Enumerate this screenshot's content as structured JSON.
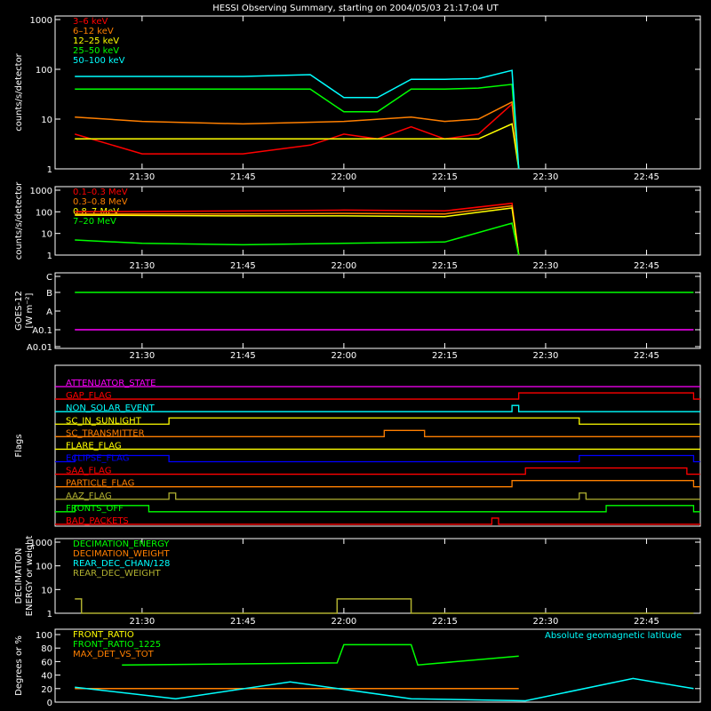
{
  "title": "HESSI Observing Summary, starting on 2004/05/03 21:17:04 UT",
  "colors": {
    "red": "#ff0000",
    "orange": "#ff7f00",
    "yellow": "#ffff00",
    "green": "#00ff00",
    "cyan": "#00ffff",
    "magenta": "#ff00ff",
    "blue": "#0000ff",
    "olive": "#b0b030",
    "white": "#ffffff",
    "axis": "#ffffff"
  },
  "chart_data": [
    {
      "id": "low_energy",
      "type": "line",
      "ylabel": "counts/s/detector",
      "log": true,
      "yticks": [
        "1",
        "10",
        "100",
        "1000"
      ],
      "yrange": [
        1,
        1000
      ],
      "xticks": [
        "21:30",
        "21:45",
        "22:00",
        "22:15",
        "22:30",
        "22:45"
      ],
      "legend": [
        "3–6 keV",
        "6–12 keV",
        "12–25 keV",
        "25–50 keV",
        "50–100 keV"
      ],
      "legend_colors": [
        "red",
        "orange",
        "yellow",
        "green",
        "cyan"
      ],
      "series": [
        {
          "name": "3–6 keV",
          "color": "red",
          "x": [
            "21:20",
            "21:30",
            "21:45",
            "21:55",
            "22:00",
            "22:05",
            "22:10",
            "22:15",
            "22:20",
            "22:25",
            "22:26"
          ],
          "y": [
            5,
            2,
            2,
            3,
            5,
            4,
            7,
            4,
            5,
            20,
            1
          ]
        },
        {
          "name": "6–12 keV",
          "color": "orange",
          "x": [
            "21:20",
            "21:30",
            "21:45",
            "22:00",
            "22:10",
            "22:15",
            "22:20",
            "22:25",
            "22:26"
          ],
          "y": [
            11,
            9,
            8,
            9,
            11,
            9,
            10,
            22,
            1
          ]
        },
        {
          "name": "12–25 keV",
          "color": "yellow",
          "x": [
            "21:20",
            "21:30",
            "21:45",
            "22:00",
            "22:15",
            "22:20",
            "22:25",
            "22:26"
          ],
          "y": [
            4,
            4,
            4,
            4,
            4,
            4,
            8,
            1
          ]
        },
        {
          "name": "25–50 keV",
          "color": "green",
          "x": [
            "21:20",
            "21:30",
            "21:45",
            "21:55",
            "22:00",
            "22:05",
            "22:10",
            "22:15",
            "22:20",
            "22:25",
            "22:26"
          ],
          "y": [
            40,
            40,
            40,
            40,
            14,
            14,
            40,
            40,
            42,
            50,
            1
          ]
        },
        {
          "name": "50–100 keV",
          "color": "cyan",
          "x": [
            "21:20",
            "21:30",
            "21:45",
            "21:55",
            "22:00",
            "22:05",
            "22:10",
            "22:15",
            "22:20",
            "22:25",
            "22:26"
          ],
          "y": [
            72,
            72,
            72,
            78,
            27,
            27,
            63,
            63,
            65,
            95,
            1
          ]
        }
      ]
    },
    {
      "id": "high_energy",
      "type": "line",
      "ylabel": "counts/s/detector",
      "log": true,
      "yticks": [
        "1",
        "10",
        "100",
        "1000"
      ],
      "yrange": [
        1,
        1000
      ],
      "xticks": [
        "21:30",
        "21:45",
        "22:00",
        "22:15",
        "22:30",
        "22:45"
      ],
      "legend": [
        "0.1–0.3 MeV",
        "0.3–0.8 MeV",
        "0.8–7 MeV",
        "7–20 MeV"
      ],
      "legend_colors": [
        "red",
        "orange",
        "yellow",
        "green"
      ],
      "series": [
        {
          "name": "0.1–0.3 MeV",
          "color": "red",
          "x": [
            "21:20",
            "21:45",
            "22:00",
            "22:15",
            "22:25",
            "22:26"
          ],
          "y": [
            100,
            110,
            120,
            110,
            250,
            1
          ]
        },
        {
          "name": "0.3–0.8 MeV",
          "color": "orange",
          "x": [
            "21:20",
            "21:45",
            "22:00",
            "22:15",
            "22:25",
            "22:26"
          ],
          "y": [
            80,
            80,
            85,
            80,
            190,
            1
          ]
        },
        {
          "name": "0.8–7 MeV",
          "color": "yellow",
          "x": [
            "21:20",
            "21:45",
            "22:00",
            "22:15",
            "22:25",
            "22:26"
          ],
          "y": [
            70,
            65,
            65,
            60,
            150,
            1
          ]
        },
        {
          "name": "7–20 MeV",
          "color": "green",
          "x": [
            "21:20",
            "21:30",
            "21:45",
            "22:00",
            "22:15",
            "22:25",
            "22:26"
          ],
          "y": [
            5,
            3.5,
            3,
            3.5,
            4,
            30,
            1
          ]
        }
      ]
    },
    {
      "id": "goes",
      "type": "line",
      "ylabel": "GOES-12",
      "ylabel2": "[W m⁻²]",
      "yticks": [
        "A0.01",
        "A0.1",
        "A",
        "B",
        "C"
      ],
      "xticks": [
        "21:30",
        "21:45",
        "22:00",
        "22:15",
        "22:30",
        "22:45"
      ],
      "series": [
        {
          "name": "",
          "color": "green",
          "x": [
            "21:20",
            "22:52"
          ],
          "y": [
            "B",
            "B"
          ]
        },
        {
          "name": "",
          "color": "magenta",
          "x": [
            "21:20",
            "22:52"
          ],
          "y": [
            "A0.1",
            "A0.1"
          ]
        }
      ]
    },
    {
      "id": "flags",
      "type": "line",
      "ylabel": "Flags",
      "flags": [
        {
          "label": "ATTENUATOR_STATE",
          "color": "magenta",
          "on": []
        },
        {
          "label": "GAP_FLAG",
          "color": "red",
          "on": [
            [
              "22:26",
              "22:52"
            ]
          ]
        },
        {
          "label": "NON_SOLAR_EVENT",
          "color": "cyan",
          "on": [
            [
              "22:25",
              "22:26"
            ]
          ]
        },
        {
          "label": "SC_IN_SUNLIGHT",
          "color": "yellow",
          "on": [
            [
              "21:34",
              "22:35"
            ]
          ]
        },
        {
          "label": "SC_TRANSMITTER",
          "color": "orange",
          "on": [
            [
              "22:06",
              "22:12"
            ]
          ]
        },
        {
          "label": "FLARE_FLAG",
          "color": "yellow",
          "on": []
        },
        {
          "label": "ECLIPSE_FLAG",
          "color": "blue",
          "on": [
            [
              "21:20",
              "21:34"
            ],
            [
              "22:35",
              "22:52"
            ]
          ]
        },
        {
          "label": "SAA_FLAG",
          "color": "red",
          "on": [
            [
              "22:27",
              "22:51"
            ]
          ]
        },
        {
          "label": "PARTICLE_FLAG",
          "color": "orange",
          "on": [
            [
              "22:25",
              "22:52"
            ]
          ]
        },
        {
          "label": "AAZ_FLAG",
          "color": "olive",
          "on": [
            [
              "21:34",
              "21:35"
            ],
            [
              "22:35",
              "22:36"
            ]
          ]
        },
        {
          "label": "FRONTS_OFF",
          "color": "green",
          "on": [
            [
              "21:20",
              "21:31"
            ],
            [
              "22:39",
              "22:52"
            ]
          ]
        },
        {
          "label": "BAD_PACKETS",
          "color": "red",
          "on": [
            [
              "22:22",
              "22:23"
            ]
          ]
        }
      ]
    },
    {
      "id": "decimation",
      "type": "line",
      "ylabel": "DECIMATION",
      "ylabel2": "ENERGY or weight",
      "log": true,
      "yticks": [
        "1",
        "10",
        "100",
        "1000"
      ],
      "yrange": [
        1,
        1000
      ],
      "xticks": [
        "21:30",
        "21:45",
        "22:00",
        "22:15",
        "22:30",
        "22:45"
      ],
      "legend": [
        "DECIMATION_ENERGY",
        "DECIMATION_WEIGHT",
        "REAR_DEC_CHAN/128",
        "REAR_DEC_WEIGHT"
      ],
      "legend_colors": [
        "green",
        "orange",
        "cyan",
        "olive"
      ],
      "series": [
        {
          "name": "REAR_DEC_WEIGHT",
          "color": "olive",
          "x": [
            "21:20",
            "21:21",
            "21:21",
            "21:59",
            "21:59",
            "22:10",
            "22:10",
            "22:52"
          ],
          "y": [
            4,
            4,
            1,
            1,
            4,
            4,
            1,
            1
          ]
        }
      ]
    },
    {
      "id": "ratios",
      "type": "line",
      "ylabel": "Degrees or %",
      "yticks": [
        "0",
        "20",
        "40",
        "60",
        "80",
        "100"
      ],
      "yrange": [
        0,
        100
      ],
      "legend": [
        "FRONT_RATIO",
        "FRONT_RATIO_1225",
        "MAX_DET_VS_TOT"
      ],
      "legend_colors": [
        "yellow",
        "green",
        "orange"
      ],
      "annotation": "Absolute geomagnetic latitude",
      "series": [
        {
          "name": "FRONT_RATIO_1225",
          "color": "green",
          "x": [
            "21:27",
            "21:59",
            "22:00",
            "22:10",
            "22:11",
            "22:26"
          ],
          "y": [
            55,
            58,
            85,
            85,
            55,
            68
          ]
        },
        {
          "name": "MAX_DET_VS_TOT",
          "color": "orange",
          "x": [
            "21:20",
            "22:26"
          ],
          "y": [
            20,
            20
          ]
        },
        {
          "name": "Absolute geomagnetic latitude",
          "color": "cyan",
          "x": [
            "21:20",
            "21:35",
            "21:52",
            "22:10",
            "22:27",
            "22:43",
            "22:52"
          ],
          "y": [
            22,
            5,
            30,
            5,
            2,
            35,
            20
          ]
        }
      ]
    }
  ]
}
